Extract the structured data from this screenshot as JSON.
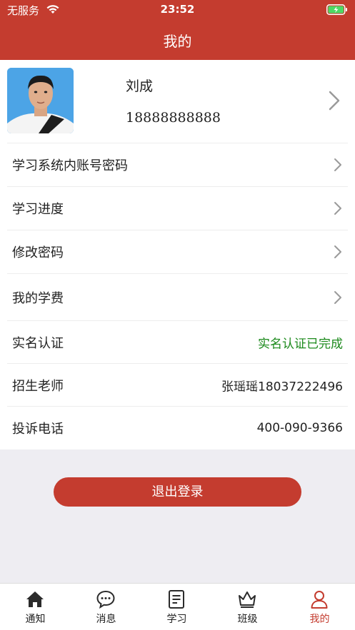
{
  "status_bar": {
    "carrier": "无服务",
    "time": "23:52"
  },
  "header": {
    "title": "我的"
  },
  "profile": {
    "name": "刘成",
    "phone": "18888888888"
  },
  "menu": [
    {
      "label": "学习系统内账号密码"
    },
    {
      "label": "学习进度"
    },
    {
      "label": "修改密码"
    },
    {
      "label": "我的学费"
    }
  ],
  "info": [
    {
      "label": "实名认证",
      "value": "实名认证已完成"
    },
    {
      "label": "招生老师",
      "value": "张瑶瑶18037222496"
    },
    {
      "label": "投诉电话",
      "value": "400-090-9366"
    }
  ],
  "logout_label": "退出登录",
  "tabs": [
    {
      "label": "通知",
      "icon": "home-icon"
    },
    {
      "label": "消息",
      "icon": "chat-bubble-icon"
    },
    {
      "label": "学习",
      "icon": "document-icon"
    },
    {
      "label": "班级",
      "icon": "crown-icon"
    },
    {
      "label": "我的",
      "icon": "user-icon"
    }
  ],
  "colors": {
    "brand_red": "#c43c2f",
    "verified_green": "#1c8a1c",
    "background": "#eeedf2"
  }
}
